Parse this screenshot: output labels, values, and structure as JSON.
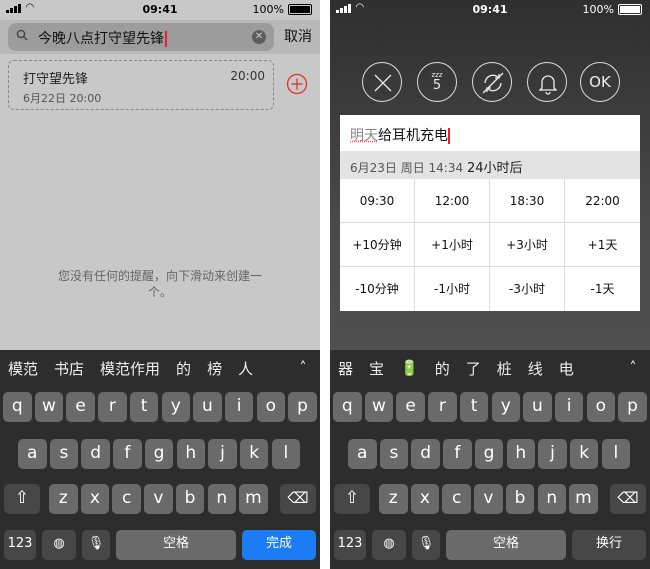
{
  "left": {
    "status": {
      "time": "09:41",
      "battery": "100%"
    },
    "search": {
      "value": "今晚八点打守望先锋",
      "cancel": "取消"
    },
    "item": {
      "title": "打守望先锋",
      "time": "20:00",
      "date": "6月22日 20:00"
    },
    "empty_message": "您没有任何的提醒，向下滑动来创建一个。",
    "keyboard": {
      "candidates": [
        "模范",
        "书店",
        "模范作用",
        "的",
        "榜",
        "人"
      ],
      "row1": [
        "q",
        "w",
        "e",
        "r",
        "t",
        "y",
        "u",
        "i",
        "o",
        "p"
      ],
      "row2": [
        "a",
        "s",
        "d",
        "f",
        "g",
        "h",
        "j",
        "k",
        "l"
      ],
      "row3": [
        "z",
        "x",
        "c",
        "v",
        "b",
        "n",
        "m"
      ],
      "num": "123",
      "space": "空格",
      "action": "完成"
    }
  },
  "right": {
    "status": {
      "time": "09:41",
      "battery": "100%"
    },
    "snooze_value": "5",
    "ok_label": "OK",
    "input": {
      "underlined": "明天",
      "text": "给耳机充电"
    },
    "info": {
      "date": "6月23日 周日 14:34",
      "relative": "24小时后"
    },
    "grid": [
      [
        "09:30",
        "12:00",
        "18:30",
        "22:00"
      ],
      [
        "+10分钟",
        "+1小时",
        "+3小时",
        "+1天"
      ],
      [
        "-10分钟",
        "-1小时",
        "-3小时",
        "-1天"
      ]
    ],
    "keyboard": {
      "candidates": [
        "器",
        "宝",
        "🔋",
        "的",
        "了",
        "桩",
        "线",
        "电"
      ],
      "row1": [
        "q",
        "w",
        "e",
        "r",
        "t",
        "y",
        "u",
        "i",
        "o",
        "p"
      ],
      "row2": [
        "a",
        "s",
        "d",
        "f",
        "g",
        "h",
        "j",
        "k",
        "l"
      ],
      "row3": [
        "z",
        "x",
        "c",
        "v",
        "b",
        "n",
        "m"
      ],
      "num": "123",
      "space": "空格",
      "action": "换行"
    }
  }
}
